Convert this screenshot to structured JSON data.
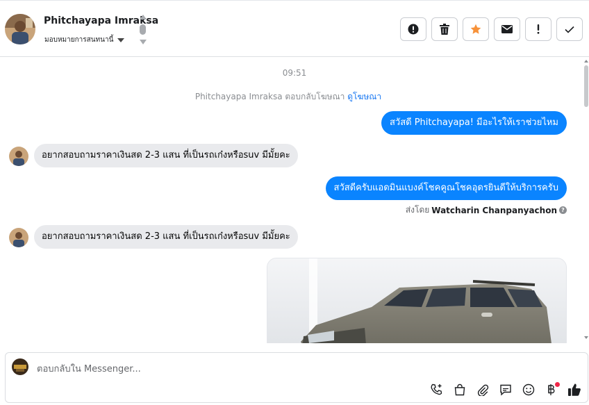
{
  "header": {
    "contact_name": "Phitchayapa Imraksa",
    "assign_label": "มอบหมายการสนทนานี้",
    "actions": [
      {
        "name": "spam-button",
        "icon": "alert-circle-icon"
      },
      {
        "name": "delete-button",
        "icon": "trash-icon"
      },
      {
        "name": "star-button",
        "icon": "star-icon",
        "color": "#f7923a"
      },
      {
        "name": "mark-unread-button",
        "icon": "envelope-icon"
      },
      {
        "name": "follow-up-button",
        "icon": "exclamation-icon"
      },
      {
        "name": "mark-done-button",
        "icon": "check-icon"
      }
    ]
  },
  "chat": {
    "timestamp": "09:51",
    "ad_reply_text": "Phitchayapa Imraksa ตอบกลับโฆษณา",
    "ad_link_text": "ดูโฆษณา",
    "messages": [
      {
        "direction": "out",
        "text": "สวัสดี Phitchayapa! มีอะไรให้เราช่วยไหม"
      },
      {
        "direction": "in",
        "text": "อยากสอบถามราคาเงินสด 2-3 แสน ที่เป็นรถเก๋งหรือsuv มีมั้ยคะ"
      },
      {
        "direction": "out",
        "text": "สวัสดีครับแอดมินแบงค์โชคคูณโชคอุดรยินดีให้บริการครับ"
      },
      {
        "direction": "in",
        "text": "อยากสอบถามราคาเงินสด 2-3 แสน ที่เป็นรถเก๋งหรือsuv มีมั้ยคะ"
      }
    ],
    "sent_by_label": "ส่งโดย",
    "sent_by_name": "Watcharin Chanpanyachon"
  },
  "composer": {
    "placeholder": "ตอบกลับใน Messenger...",
    "tools": [
      "phone-plus-icon",
      "shopping-bag-icon",
      "paperclip-icon",
      "saved-reply-icon",
      "emoji-icon",
      "baht-payment-icon",
      "thumbs-up-icon"
    ]
  },
  "colors": {
    "outgoing_bubble": "#0a84ff",
    "incoming_bubble": "#e9eaed",
    "star": "#f7923a",
    "link": "#1877f2"
  }
}
